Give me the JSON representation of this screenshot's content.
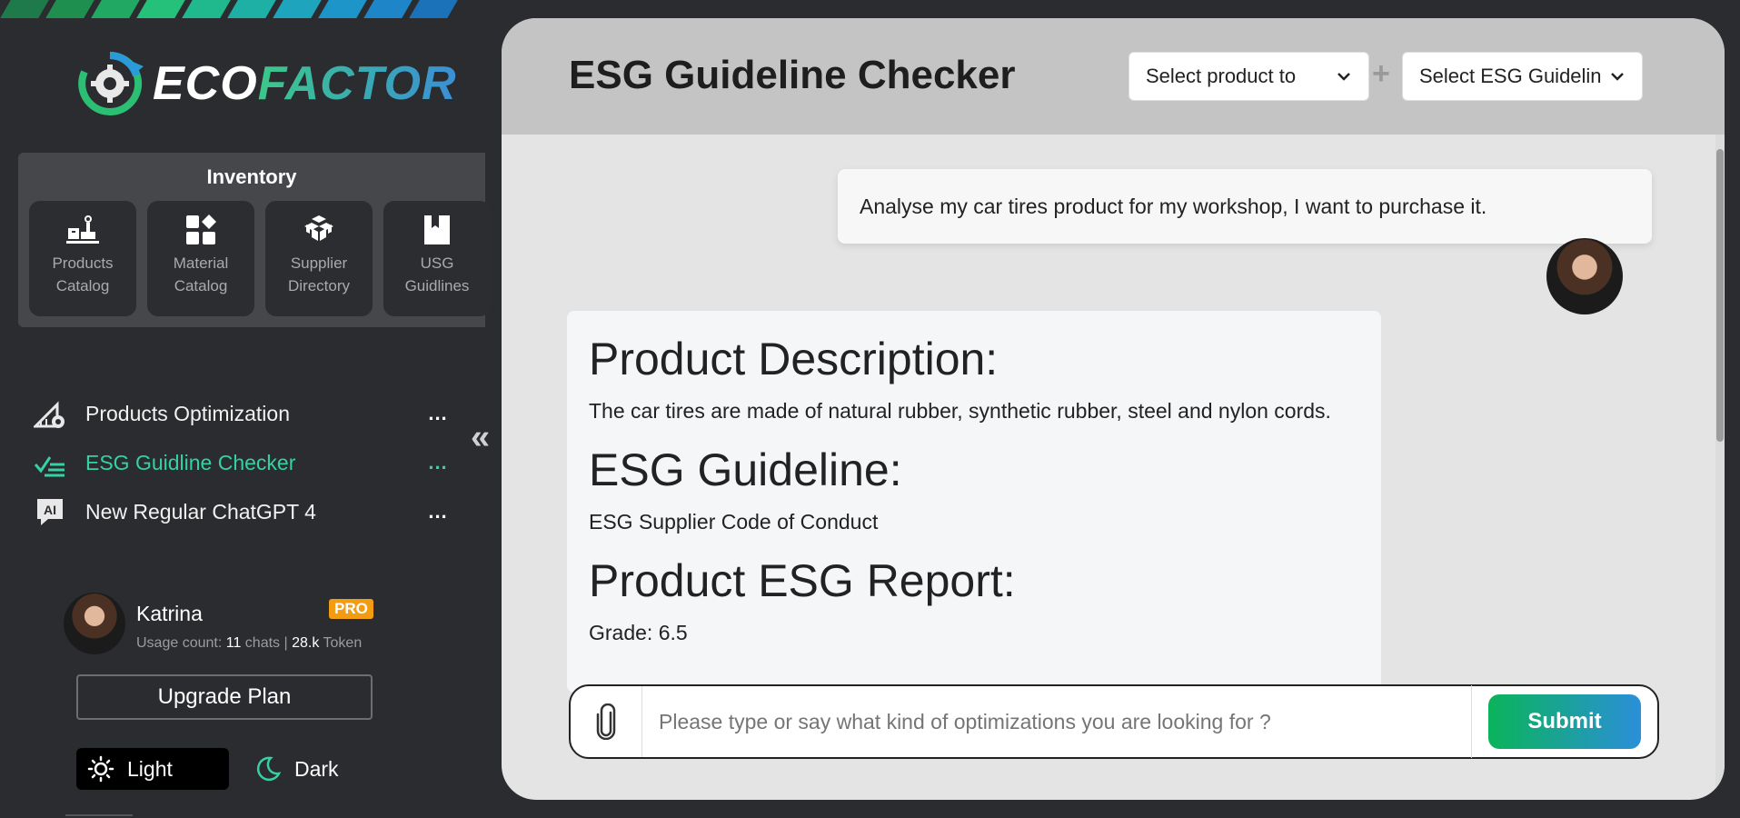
{
  "brand": {
    "part1": "ECO",
    "part2": "FACTOR"
  },
  "inventory": {
    "title": "Inventory",
    "tiles": [
      {
        "label": "Products Catalog",
        "icon": "products-icon"
      },
      {
        "label": "Material Catalog",
        "icon": "material-icon"
      },
      {
        "label": "Supplier Directory",
        "icon": "supplier-icon"
      },
      {
        "label": "USG Guidlines",
        "icon": "guidelines-icon"
      }
    ]
  },
  "nav": {
    "items": [
      {
        "label": "Products Optimization",
        "icon": "optimization-icon",
        "active": false
      },
      {
        "label": "ESG Guidline Checker",
        "icon": "checklist-icon",
        "active": true
      },
      {
        "label": "New Regular ChatGPT 4",
        "icon": "ai-icon",
        "active": false
      }
    ],
    "more_label": "..."
  },
  "collapse_label": "«",
  "profile": {
    "name": "Katrina",
    "badge": "PRO",
    "usage_prefix": "Usage count:",
    "chats_count": "11",
    "chats_label": "chats",
    "separator": "|",
    "tokens_count": "28.k",
    "tokens_label": "Token"
  },
  "upgrade_label": "Upgrade Plan",
  "theme": {
    "light_label": "Light",
    "dark_label": "Dark",
    "selected": "light"
  },
  "main": {
    "title": "ESG Guideline Checker",
    "product_select": "Select product to",
    "guideline_select": "Select ESG Guideline",
    "plus": "+"
  },
  "chat": {
    "user_message": "Analyse my car tires product for my workshop, I want to purchase it.",
    "response": {
      "h1": "Product Description:",
      "p1": "The car tires are made of natural rubber, synthetic rubber, steel and nylon cords.",
      "h2": "ESG Guideline:",
      "p2": "ESG Supplier Code of Conduct",
      "h3": "Product ESG Report:",
      "p3": "Grade: 6.5"
    }
  },
  "composer": {
    "placeholder": "Please type or say what kind of optimizations you are looking for ?",
    "submit_label": "Submit"
  },
  "colors": {
    "accent": "#34d1a4",
    "pro": "#f39c12",
    "submit_start": "#0ab45a",
    "submit_end": "#2b8fd9"
  }
}
